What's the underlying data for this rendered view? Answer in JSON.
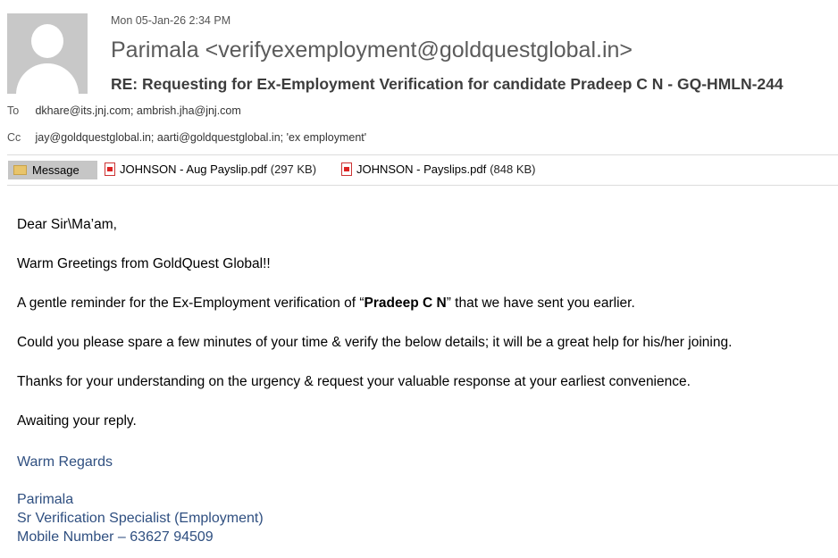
{
  "header": {
    "date": "Mon 05-Jan-26 2:34 PM",
    "sender": "Parimala <verifyexemployment@goldquestglobal.in>",
    "subject": "RE: Requesting for Ex-Employment Verification for candidate Pradeep C N - GQ-HMLN-244",
    "to_label": "To",
    "to": "dkhare@its.jnj.com; ambrish.jha@jnj.com",
    "cc_label": "Cc",
    "cc": "jay@goldquestglobal.in; aarti@goldquestglobal.in; 'ex employment'"
  },
  "tabs": {
    "message_label": "Message",
    "attachments": [
      {
        "name": "JOHNSON - Aug Payslip.pdf",
        "size": "(297 KB)"
      },
      {
        "name": "JOHNSON - Payslips.pdf",
        "size": "(848 KB)"
      }
    ]
  },
  "body": {
    "greeting": "Dear Sir\\Ma’am,",
    "line1": "Warm Greetings from GoldQuest Global!!",
    "line2_pre": "A gentle reminder for the Ex-Employment verification of “",
    "line2_bold": "Pradeep C N",
    "line2_post": "” that we have sent you earlier.",
    "line3": "Could you please spare a few minutes of your time & verify the below details; it will be a great help for his/her joining.",
    "line4": "Thanks for your understanding on the urgency & request your valuable response at your earliest convenience.",
    "line5": "Awaiting your reply."
  },
  "signature": {
    "closing": "Warm Regards",
    "name": "Parimala",
    "title": "Sr Verification Specialist (Employment)",
    "mobile": "Mobile Number – 63627 94509"
  }
}
